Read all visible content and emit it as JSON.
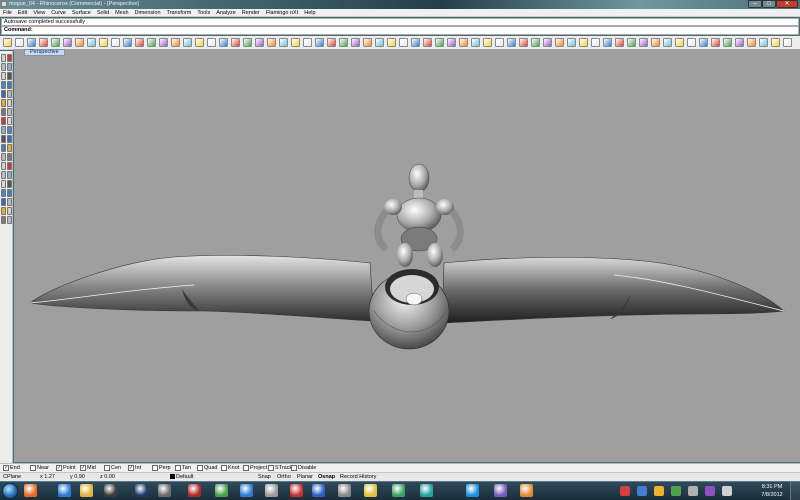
{
  "window": {
    "title": "mogue_04 - Rhinoceros (Commercial) - [Perspective]",
    "minimize_glyph": "–",
    "maximize_glyph": "□",
    "close_glyph": "✕"
  },
  "menu": [
    "File",
    "Edit",
    "View",
    "Curve",
    "Surface",
    "Solid",
    "Mesh",
    "Dimension",
    "Transform",
    "Tools",
    "Analyze",
    "Render",
    "Flamingo nXt",
    "Help"
  ],
  "history_line": "Autosave completed successfully",
  "command": {
    "label": "Command:",
    "value": ""
  },
  "viewport": {
    "tab": "Perspective",
    "background": "#9f9f9f"
  },
  "osnaps": [
    {
      "label": "End",
      "checked": true
    },
    {
      "label": "Near",
      "checked": false
    },
    {
      "label": "Point",
      "checked": true
    },
    {
      "label": "Mid",
      "checked": true
    },
    {
      "label": "Cen",
      "checked": false
    },
    {
      "label": "Int",
      "checked": true
    },
    {
      "label": "Perp",
      "checked": false
    },
    {
      "label": "Tan",
      "checked": false
    },
    {
      "label": "Quad",
      "checked": false
    },
    {
      "label": "Knot",
      "checked": false
    },
    {
      "label": "Project",
      "checked": false
    },
    {
      "label": "STrack",
      "checked": false
    },
    {
      "label": "Disable",
      "checked": false
    }
  ],
  "status": {
    "cplane": "CPlane",
    "x": "x 1.27",
    "y": "y 0.90",
    "z": "z 0.00",
    "layer": "Default",
    "snap": "Snap",
    "ortho": "Ortho",
    "planar": "Planar",
    "osnap": "Osnap",
    "record_history": "Record History"
  },
  "clock": {
    "time": "8:31 PM",
    "date": "7/8/2012"
  },
  "toolbar_icons": [
    "new-icon",
    "open-icon",
    "save-icon",
    "print-icon",
    "import-icon",
    "cut-icon",
    "copy-icon",
    "paste-icon",
    "undo-icon",
    "pan-icon",
    "rotate-view-icon",
    "zoom-icon",
    "zoom-window-icon",
    "zoom-extents-icon",
    "zoom-selected-icon",
    "zoom-extents-all-icon",
    "undo-view-icon",
    "4-viewports-icon",
    "set-cplane-icon",
    "show-object-icon",
    "hide-object-icon",
    "lock-icon",
    "layer-icon",
    "properties-icon",
    "select-icon",
    "wireframe-icon",
    "shaded-icon",
    "rendered-icon",
    "render-icon",
    "material-icon",
    "ghosted-icon",
    "help-icon",
    "grid-icon",
    "snap-icon",
    "extra-1-icon",
    "extra-2-icon",
    "extra-3-icon",
    "extra-4-icon",
    "extra-5-icon",
    "extra-6-icon",
    "extra-7-icon",
    "extra-8-icon",
    "extra-9-icon",
    "extra-10-icon",
    "extra-11-icon",
    "extra-12-icon",
    "extra-13-icon",
    "extra-14-icon",
    "extra-15-icon",
    "extra-16-icon",
    "extra-17-icon",
    "extra-18-icon",
    "extra-19-icon",
    "extra-20-icon",
    "extra-21-icon",
    "extra-22-icon",
    "extra-23-icon",
    "extra-24-icon",
    "extra-25-icon",
    "extra-26-icon",
    "extra-27-icon",
    "extra-28-icon",
    "extra-29-icon",
    "extra-30-icon",
    "extra-31-icon",
    "extra-32-icon"
  ],
  "taskbar_apps": [
    "firefox-icon",
    "internet-explorer-icon",
    "windows-explorer-icon",
    "media-player-icon",
    "photoshop-icon",
    "sketchup-icon",
    "app-s-icon",
    "chrome-icon",
    "ie-alt-icon",
    "rhino-icon",
    "app-red-icon",
    "app-blue-icon",
    "app-gray-icon",
    "app-yellow-icon",
    "app-green-icon",
    "app-teal-icon",
    "skype-icon",
    "app-purple-icon",
    "app-orange-icon"
  ]
}
